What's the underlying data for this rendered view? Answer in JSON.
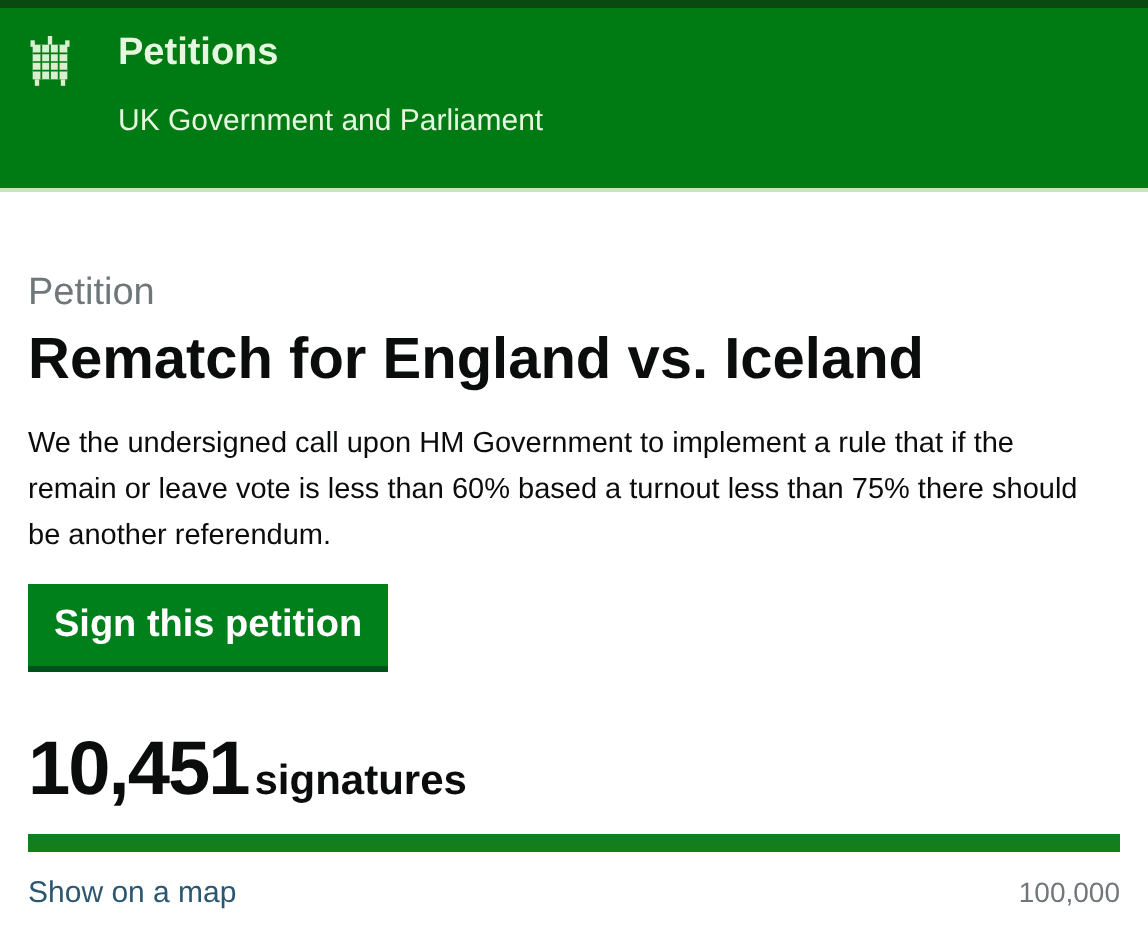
{
  "header": {
    "title": "Petitions",
    "subtitle": "UK Government and Parliament"
  },
  "petition": {
    "label": "Petition",
    "title": "Rematch for England vs. Iceland",
    "description": "We the undersigned call upon HM Government to implement a rule that if the remain or leave vote is less than 60% based a turnout less than 75% there should be another referendum.",
    "button": "Sign this petition"
  },
  "signatures": {
    "count": "10,451",
    "unit": "signatures",
    "level": 1,
    "map_link": "Show on a map",
    "target": "100,000"
  }
}
